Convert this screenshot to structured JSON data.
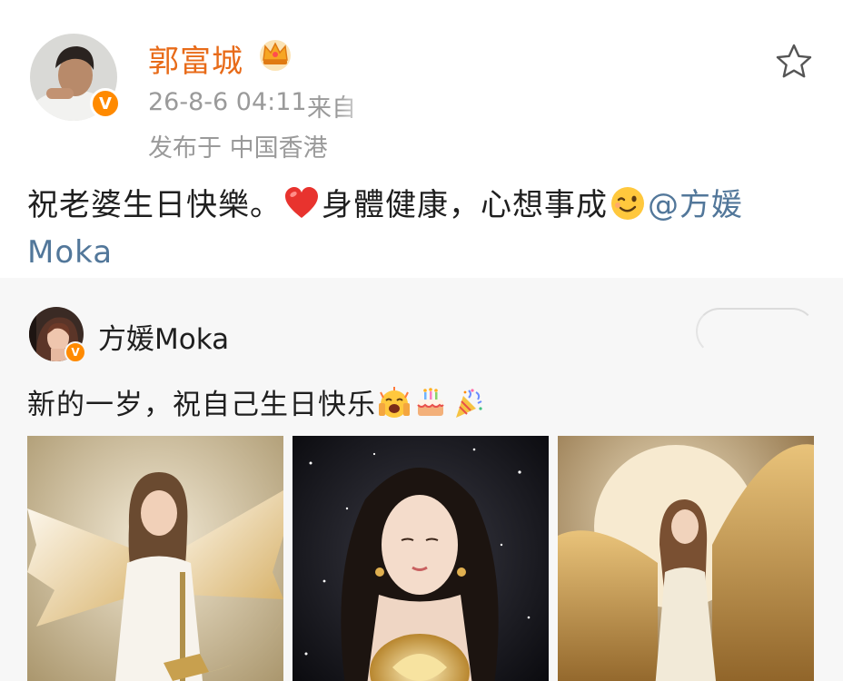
{
  "post": {
    "author": "郭富城",
    "time": "26-8-6 04:11",
    "source": "来自",
    "location": "发布于 中国香港",
    "text_part1": "祝老婆生日快樂。",
    "text_part2": "身體健康，心想事成",
    "mention_first": "@方媛",
    "mention_second": "Moka",
    "verified_badge": "V",
    "icons": [
      "crown-icon",
      "star-icon",
      "heart-emoji",
      "wink-emoji"
    ]
  },
  "repost": {
    "author": "方媛Moka",
    "text": "新的一岁，祝自己生日快乐",
    "verified_badge": "V",
    "icons": [
      "cheers-emoji",
      "cake-emoji",
      "confetti-emoji"
    ],
    "photos": [
      "angel-moon-photo",
      "golden-rose-photo",
      "golden-wings-photo"
    ]
  },
  "colors": {
    "author_orange": "#e86b19",
    "mention_blue": "#52779a",
    "meta_gray": "#9a9a9a",
    "badge_orange": "#ff8a00",
    "repost_bg": "#f7f7f7"
  }
}
